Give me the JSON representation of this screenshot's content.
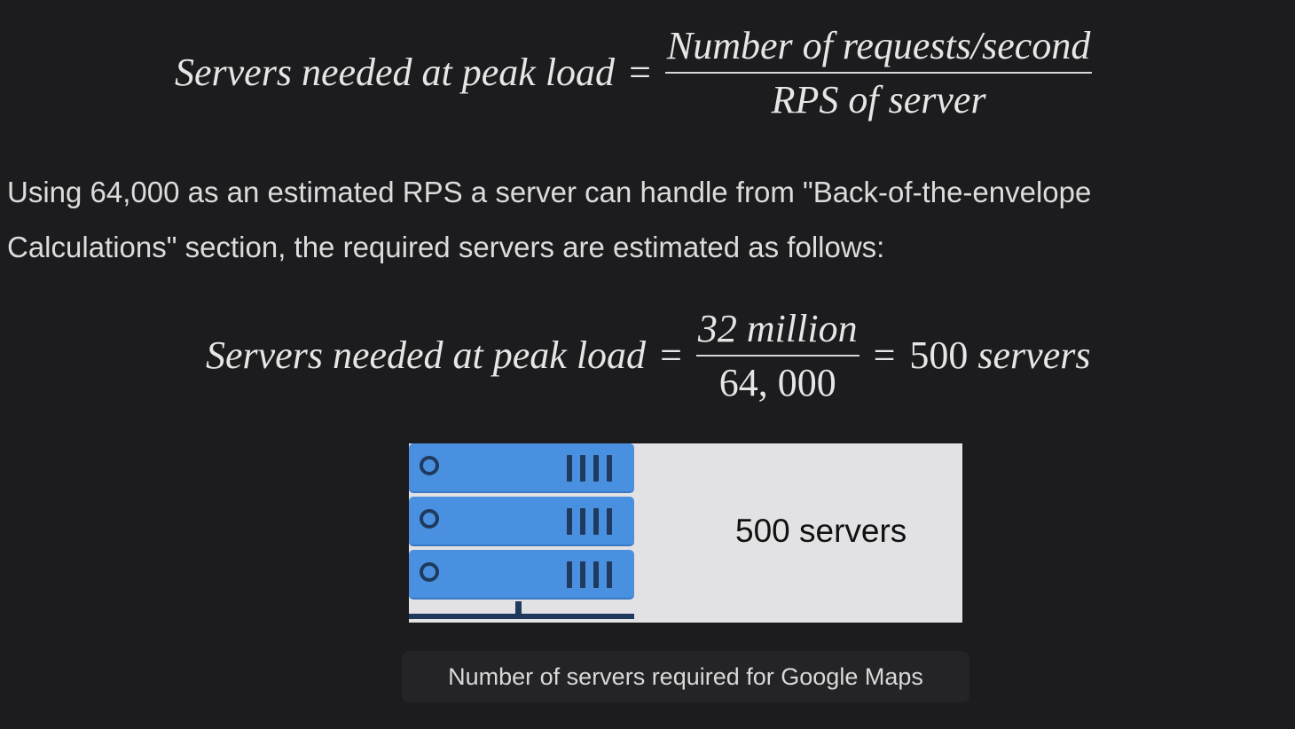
{
  "formula_general": {
    "lhs": "Servers needed at peak load",
    "operator": "=",
    "numerator": "Number of requests/second",
    "denominator": "RPS of server"
  },
  "paragraph": "Using 64,000 as an estimated RPS a server can handle from \"Back-of-the-envelope Calculations\" section, the required servers are estimated as follows:",
  "formula_specific": {
    "lhs": "Servers needed at peak load",
    "operator": "=",
    "numerator": "32 million",
    "denominator": "64, 000",
    "result_operator": "=",
    "result_value": "500",
    "result_unit": "servers"
  },
  "figure": {
    "label": "500 servers",
    "server_units": 3,
    "colors": {
      "server_blue": "#4a90e0",
      "server_dark": "#1f3a5c",
      "figure_bg": "#e2e2e4"
    },
    "icon": "server-rack-icon"
  },
  "caption": "Number of servers required for Google Maps"
}
